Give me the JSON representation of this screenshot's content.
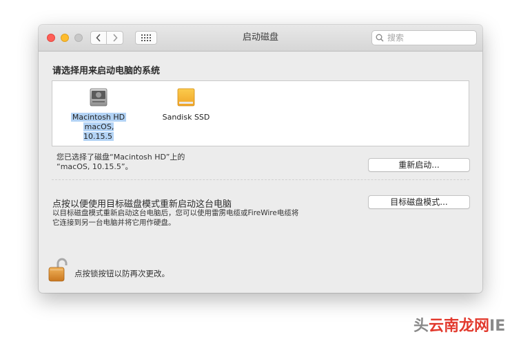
{
  "window": {
    "title": "启动磁盘"
  },
  "search": {
    "placeholder": "搜索"
  },
  "heading": "请选择用来启动电脑的系统",
  "disks": [
    {
      "name": "Macintosh HD",
      "version": "macOS, 10.15.5",
      "selected": true,
      "icon": "internal-hard-disk-icon"
    },
    {
      "name": "Sandisk SSD",
      "version": "",
      "selected": false,
      "icon": "external-disk-icon"
    }
  ],
  "status": {
    "line1": "您已选择了磁盘“Macintosh HD”上的",
    "line2": "“macOS, 10.15.5”。"
  },
  "buttons": {
    "restart": "重新启动...",
    "target_disk_mode": "目标磁盘模式..."
  },
  "target_disk_mode": {
    "title": "点按以便使用目标磁盘模式重新启动这台电脑",
    "line1": "以目标磁盘模式重新启动这台电脑后，您可以使用雷雳电缆或FireWire电缆将",
    "line2": "它连接到另一台电脑并将它用作硬盘。"
  },
  "lock": {
    "text": "点按锁按钮以防再次更改。",
    "icon": "lock-open-icon"
  },
  "watermark": {
    "lead": "头",
    "brand": "云南龙网",
    "tail": "IE"
  },
  "colors": {
    "selection": "#b3d3f5",
    "close": "#fe5f57",
    "minimize": "#febc2e",
    "external_disk": "#f6b73c"
  }
}
